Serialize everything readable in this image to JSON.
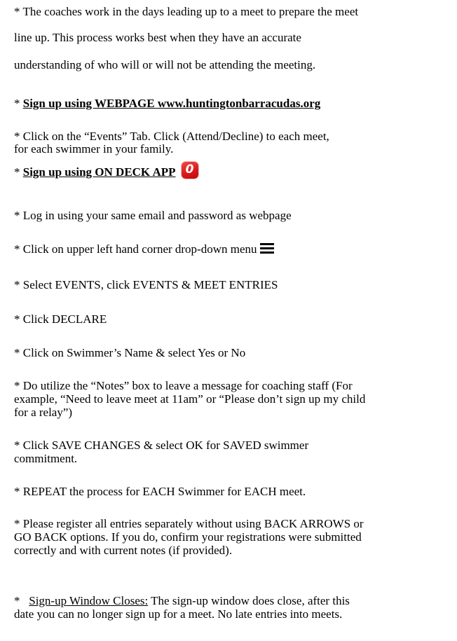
{
  "intro": {
    "line1": "* The coaches work in the days leading up to a meet to prepare the meet",
    "line2": "line up.  This process works best when they have an accurate",
    "line3": "understanding of who will or will not be attending the meeting."
  },
  "webpage_section": {
    "bullet": "* ",
    "heading": "Sign up using WEBPAGE www.huntingtonbarracudas.org",
    "text_line1": "* Click on the “Events” Tab. Click (Attend/Decline) to each meet,",
    "text_line2": "for each swimmer in your family."
  },
  "app_section": {
    "bullet": "* ",
    "heading": "Sign up using ON DECK APP",
    "app_icon_glyph": "0",
    "app_icon": "on-deck-app-icon",
    "app_icon_color": "#d81818"
  },
  "steps": {
    "login": "* Log in using your same email and password as webpage",
    "menu": "* Click on upper left hand corner drop-down menu",
    "menu_icon": "hamburger-menu-icon",
    "select_events": "* Select EVENTS, click EVENTS & MEET ENTRIES",
    "declare": "* Click DECLARE",
    "swimmer_name": "* Click on Swimmer’s Name & select Yes or No",
    "notes_line1": "* Do utilize the “Notes” box to leave a message for coaching staff (For",
    "notes_line2": "example, “Need to leave meet at 11am” or “Please don’t sign up my child",
    "notes_line3": "for a relay”)",
    "save_line1": "* Click SAVE CHANGES & select OK for SAVED swimmer",
    "save_line2": "commitment.",
    "repeat": "* REPEAT the process for EACH Swimmer for EACH meet.",
    "register_line1": "* Please register all entries separately without using BACK ARROWS or",
    "register_line2": "GO BACK options.  If you do, confirm your registrations were submitted",
    "register_line3": "correctly and with current notes (if provided)."
  },
  "closing": {
    "bullet": "*   ",
    "heading": "Sign-up Window Closes:",
    "text_line1": " The sign-up window does close, after this",
    "text_line2": "date you can no longer sign up for a meet. No late entries into meets."
  }
}
